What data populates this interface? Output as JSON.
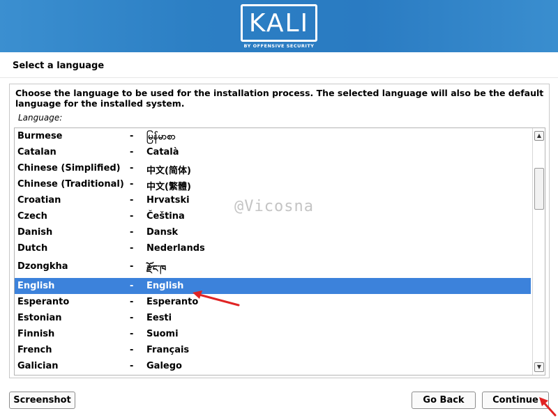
{
  "header": {
    "logo_text": "KALI",
    "logo_subtitle": "BY OFFENSIVE SECURITY",
    "banner_color": "#2c7fc4"
  },
  "page_title": "Select a language",
  "instructions": "Choose the language to be used for the installation process. The selected language will also be the default language for the installed system.",
  "list_label": "Language:",
  "languages": [
    {
      "name": "Burmese",
      "native": "မြန်မာစာ"
    },
    {
      "name": "Catalan",
      "native": "Català"
    },
    {
      "name": "Chinese (Simplified)",
      "native": "中文(简体)"
    },
    {
      "name": "Chinese (Traditional)",
      "native": "中文(繁體)"
    },
    {
      "name": "Croatian",
      "native": "Hrvatski"
    },
    {
      "name": "Czech",
      "native": "Čeština"
    },
    {
      "name": "Danish",
      "native": "Dansk"
    },
    {
      "name": "Dutch",
      "native": "Nederlands"
    },
    {
      "name": "Dzongkha",
      "native": "རྫོང་ཁ"
    },
    {
      "name": "English",
      "native": "English"
    },
    {
      "name": "Esperanto",
      "native": "Esperanto"
    },
    {
      "name": "Estonian",
      "native": "Eesti"
    },
    {
      "name": "Finnish",
      "native": "Suomi"
    },
    {
      "name": "French",
      "native": "Français"
    },
    {
      "name": "Galician",
      "native": "Galego"
    }
  ],
  "separator": "-",
  "selected_language": "English",
  "selection_color": "#3c82db",
  "buttons": {
    "screenshot": "Screenshot",
    "go_back": "Go Back",
    "continue": "Continue"
  },
  "watermark": "@Vicosna",
  "annotation_color": "#e02424"
}
